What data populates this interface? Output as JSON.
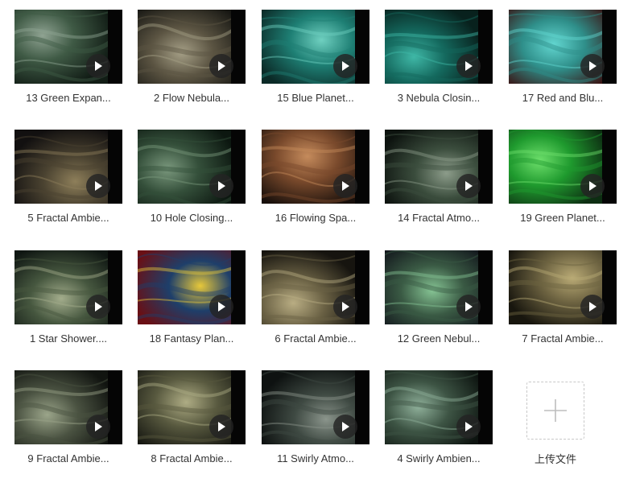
{
  "files": [
    {
      "name": "13 Green Expan...",
      "colors": [
        "#121d16",
        "#3f5a45",
        "#8fa392"
      ]
    },
    {
      "name": "2 Flow Nebula...",
      "colors": [
        "#171713",
        "#5b5442",
        "#a59f86"
      ]
    },
    {
      "name": "15 Blue Planet...",
      "colors": [
        "#0b2a27",
        "#1e7f74",
        "#6fd0c0"
      ]
    },
    {
      "name": "3 Nebula Closin...",
      "colors": [
        "#08211d",
        "#14695e",
        "#3fb7a6"
      ]
    },
    {
      "name": "17 Red and Blu...",
      "colors": [
        "#3a0c0c",
        "#2f8f8a",
        "#62d6d0"
      ]
    },
    {
      "name": "5 Fractal Ambie...",
      "colors": [
        "#121010",
        "#4b4331",
        "#8e7f5a"
      ]
    },
    {
      "name": "10 Hole Closing...",
      "colors": [
        "#0c1710",
        "#344f3a",
        "#7a987d"
      ]
    },
    {
      "name": "16 Flowing Spa...",
      "colors": [
        "#170f0b",
        "#7a4a2c",
        "#c58b5c"
      ]
    },
    {
      "name": "14 Fractal Atmo...",
      "colors": [
        "#0d130f",
        "#3b4d3d",
        "#8c9c8a"
      ]
    },
    {
      "name": "19 Green Planet...",
      "colors": [
        "#0d2e12",
        "#1f9a2e",
        "#6ee06c"
      ]
    },
    {
      "name": "1 Star Shower....",
      "colors": [
        "#0f1612",
        "#46573f",
        "#a3ad8c"
      ]
    },
    {
      "name": "18 Fantasy Plan...",
      "colors": [
        "#6a0f14",
        "#1e3f6a",
        "#e7c83a"
      ]
    },
    {
      "name": "6 Fractal Ambie...",
      "colors": [
        "#16140f",
        "#6a6144",
        "#b9ad83"
      ]
    },
    {
      "name": "12 Green Nebul...",
      "colors": [
        "#10131a",
        "#3a5a44",
        "#86c494"
      ]
    },
    {
      "name": "7 Fractal Ambie...",
      "colors": [
        "#18160e",
        "#6d6341",
        "#b9aa75"
      ]
    },
    {
      "name": "9 Fractal Ambie...",
      "colors": [
        "#111410",
        "#4a5241",
        "#9ba58a"
      ]
    },
    {
      "name": "8 Fractal Ambie...",
      "colors": [
        "#141510",
        "#58593f",
        "#aeac84"
      ]
    },
    {
      "name": "11 Swirly Atmo...",
      "colors": [
        "#0e1211",
        "#3f4a43",
        "#8b958c"
      ]
    },
    {
      "name": "4 Swirly Ambien...",
      "colors": [
        "#0d1410",
        "#3d5444",
        "#8fb09a"
      ]
    }
  ],
  "upload": {
    "label": "上传文件",
    "icon": "plus-icon"
  }
}
